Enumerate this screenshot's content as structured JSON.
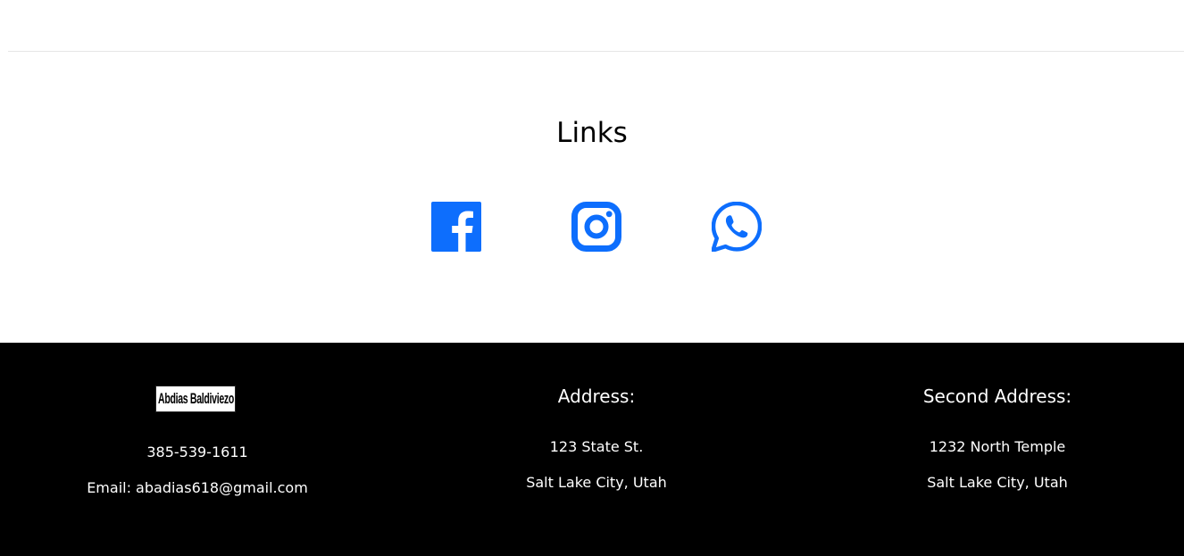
{
  "links": {
    "title": "Links",
    "items": [
      {
        "name": "Facebook",
        "icon": "facebook-icon"
      },
      {
        "name": "Instagram",
        "icon": "instagram-icon"
      },
      {
        "name": "WhatsApp",
        "icon": "whatsapp-icon"
      }
    ],
    "icon_color": "#0d6efd"
  },
  "footer": {
    "background": "#000000",
    "text_color": "#ffffff",
    "contact": {
      "logo_text": "Abdias Baldiviezo",
      "phone": "385-539-1611",
      "email": "Email: abadias618@gmail.com"
    },
    "address": {
      "heading": "Address:",
      "line1": "123 State St.",
      "line2": "Salt Lake City, Utah"
    },
    "second_address": {
      "heading": "Second Address:",
      "line1": "1232 North Temple",
      "line2": "Salt Lake City, Utah"
    }
  }
}
